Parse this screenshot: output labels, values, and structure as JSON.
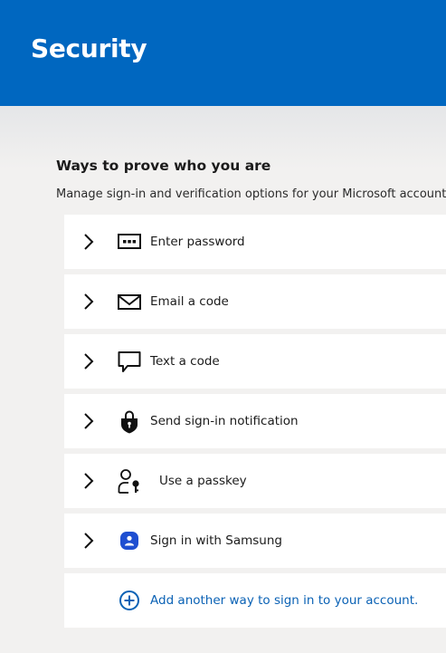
{
  "header": {
    "title": "Security"
  },
  "section": {
    "title": "Ways to prove who you are",
    "subtitle": "Manage sign-in and verification options for your Microsoft account."
  },
  "methods": [
    {
      "label": "Enter password",
      "icon": "password-icon"
    },
    {
      "label": "Email a code",
      "icon": "email-icon"
    },
    {
      "label": "Text a code",
      "icon": "chat-bubble-icon"
    },
    {
      "label": "Send sign-in notification",
      "icon": "lock-shield-icon"
    },
    {
      "label": "Use a passkey",
      "icon": "user-key-icon"
    },
    {
      "label": "Sign in with Samsung",
      "icon": "samsung-icon"
    }
  ],
  "add_method": {
    "label": "Add another way to sign in to your account.",
    "icon": "plus-circle-icon"
  },
  "colors": {
    "header_bg": "#0067c0",
    "link": "#0b62b5",
    "samsung": "#1f4fd1"
  }
}
